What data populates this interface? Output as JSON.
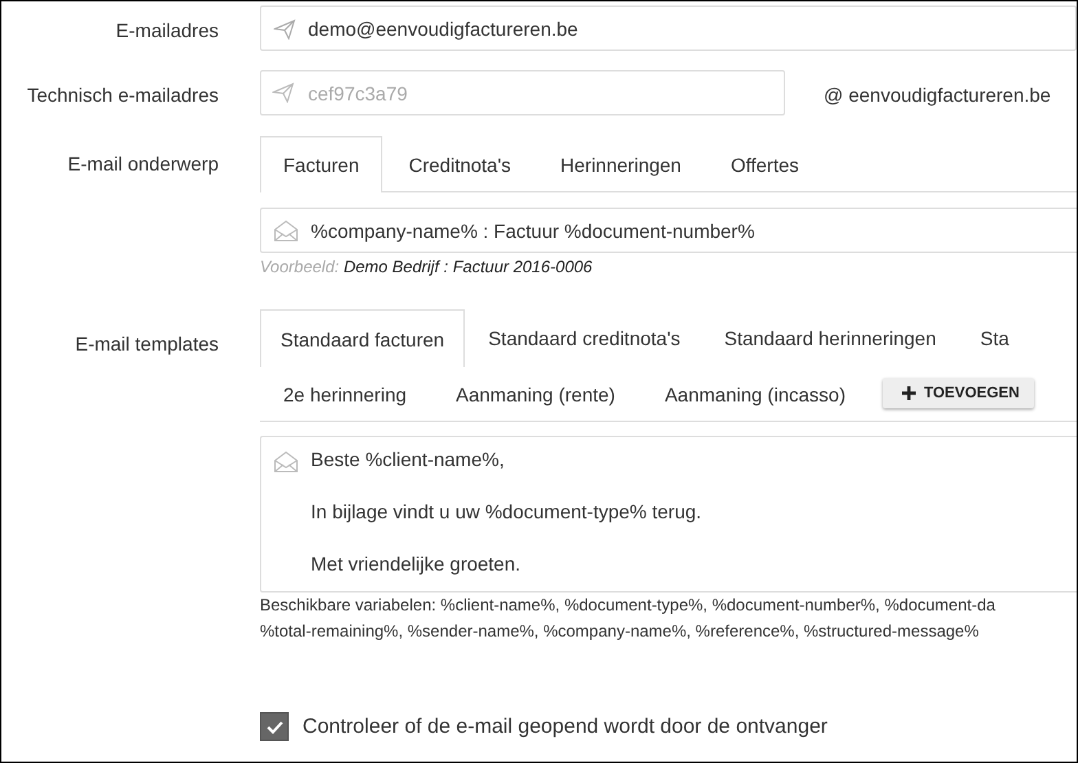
{
  "email": {
    "label": "E-mailadres",
    "value": "demo@eenvoudigfactureren.be"
  },
  "technical_email": {
    "label": "Technisch e-mailadres",
    "placeholder": "cef97c3a79",
    "suffix": "@ eenvoudigfactureren.be"
  },
  "subject": {
    "label": "E-mail onderwerp",
    "tabs": [
      {
        "label": "Facturen",
        "selected": true
      },
      {
        "label": "Creditnota's",
        "selected": false
      },
      {
        "label": "Herinneringen",
        "selected": false
      },
      {
        "label": "Offertes",
        "selected": false
      }
    ],
    "value": "%company-name% : Factuur %document-number%",
    "example_label": "Voorbeeld:",
    "example": "Demo Bedrijf : Factuur 2016-0006"
  },
  "templates": {
    "label": "E-mail templates",
    "tabs": [
      {
        "label": "Standaard facturen",
        "selected": true
      },
      {
        "label": "Standaard creditnota's",
        "selected": false
      },
      {
        "label": "Standaard herinneringen",
        "selected": false
      },
      {
        "label": "Sta",
        "selected": false
      },
      {
        "label": "2e herinnering",
        "selected": false
      },
      {
        "label": "Aanmaning (rente)",
        "selected": false
      },
      {
        "label": "Aanmaning (incasso)",
        "selected": false
      }
    ],
    "add_button": "TOEVOEGEN",
    "body": [
      "Beste %client-name%,",
      "In bijlage vindt u uw %document-type% terug.",
      "Met vriendelijke groeten."
    ],
    "variables": [
      "Beschikbare variabelen: %client-name%, %document-type%, %document-number%, %document-da",
      "%total-remaining%, %sender-name%, %company-name%, %reference%, %structured-message%"
    ]
  },
  "track_open": {
    "label": "Controleer of de e-mail geopend wordt door de ontvanger",
    "checked": true
  }
}
